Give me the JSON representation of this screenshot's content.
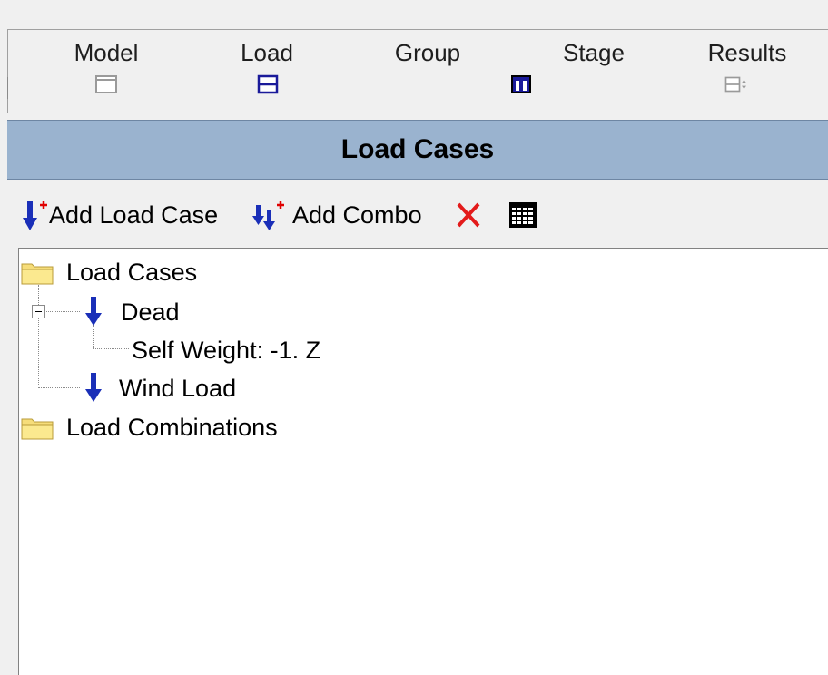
{
  "mode_tabs": [
    {
      "label": "Model",
      "icon": "model-icon",
      "active": false
    },
    {
      "label": "Load",
      "icon": "load-icon",
      "active": true
    },
    {
      "label": "Group",
      "icon": "group-icon",
      "active": false
    },
    {
      "label": "Stage",
      "icon": "stage-icon",
      "active": false
    },
    {
      "label": "Results",
      "icon": "results-icon",
      "active": false
    }
  ],
  "panel": {
    "title": "Load Cases"
  },
  "toolbar": {
    "add_load_case_label": "Add Load Case",
    "add_combo_label": "Add Combo",
    "delete_icon": "delete-x-icon",
    "table_icon": "table-grid-icon"
  },
  "tree": {
    "load_cases_folder": "Load Cases",
    "dead_case": "Dead",
    "self_weight": "Self Weight: -1. Z",
    "wind_case": "Wind Load",
    "load_combinations_folder": "Load Combinations"
  },
  "colors": {
    "title_bar": "#9ab3cf",
    "load_arrow": "#1a2fb8",
    "plus_red": "#e00000",
    "delete_red": "#e31b1b",
    "folder_yellow": "#f6dd7a"
  }
}
